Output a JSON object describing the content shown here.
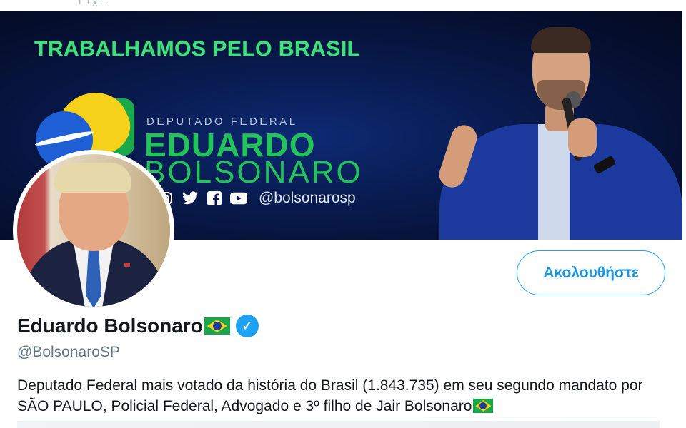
{
  "top_strip": {
    "ghost_text": "Γ τ χ ..."
  },
  "banner": {
    "headline": "TRABALHAMOS PELO BRASIL",
    "subtitle": "DEPUTADO FEDERAL",
    "name_line1": "EDUARDO",
    "name_line2": "BOLSONARO",
    "social_handle": "@bolsonarosp",
    "social_icons": [
      "instagram-icon",
      "twitter-icon",
      "facebook-icon",
      "youtube-icon"
    ]
  },
  "profile": {
    "display_name": "Eduardo Bolsonaro",
    "handle": "@BolsonaroSP",
    "verified": true,
    "bio": "Deputado Federal mais votado da história do Brasil (1.843.735) em seu segundo mandato por SÃO PAULO, Policial Federal, Advogado e 3º filho de Jair Bolsonaro"
  },
  "actions": {
    "follow_label": "Ακολουθήστε"
  },
  "colors": {
    "accent": "#1da1f2",
    "banner_green": "#22c45a",
    "text_secondary": "#657786"
  }
}
